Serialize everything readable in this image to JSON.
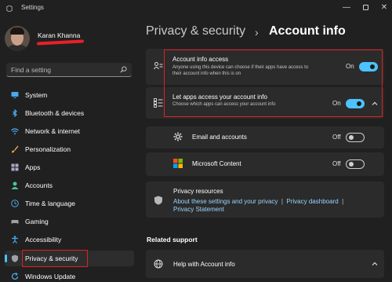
{
  "window": {
    "title": "Settings",
    "minimize": "—",
    "close": "✕"
  },
  "user": {
    "name": "Karan Khanna"
  },
  "search": {
    "placeholder": "Find a setting"
  },
  "sidebar": {
    "items": [
      {
        "label": "System",
        "icon": "monitor-icon"
      },
      {
        "label": "Bluetooth & devices",
        "icon": "bluetooth-icon"
      },
      {
        "label": "Network & internet",
        "icon": "wifi-icon"
      },
      {
        "label": "Personalization",
        "icon": "brush-icon"
      },
      {
        "label": "Apps",
        "icon": "apps-icon"
      },
      {
        "label": "Accounts",
        "icon": "person-icon"
      },
      {
        "label": "Time & language",
        "icon": "globe-clock-icon"
      },
      {
        "label": "Gaming",
        "icon": "controller-icon"
      },
      {
        "label": "Accessibility",
        "icon": "accessibility-icon"
      },
      {
        "label": "Privacy & security",
        "icon": "shield-icon",
        "selected": true
      },
      {
        "label": "Windows Update",
        "icon": "update-icon"
      }
    ]
  },
  "breadcrumb": {
    "parent": "Privacy & security",
    "separator": "›",
    "current": "Account info"
  },
  "settings": {
    "account_info_access": {
      "title": "Account info access",
      "description": "Anyone using this device can choose if their apps have access to their account info when this is on",
      "state": "On"
    },
    "let_apps_access": {
      "title": "Let apps access your account info",
      "description": "Choose which apps can access your account info",
      "state": "On"
    },
    "apps": [
      {
        "name": "Email and accounts",
        "state": "Off",
        "icon": "gear-icon"
      },
      {
        "name": "Microsoft Content",
        "state": "Off",
        "icon": "microsoft-logo-icon"
      }
    ]
  },
  "privacy_resources": {
    "title": "Privacy resources",
    "link1": "About these settings and your privacy",
    "link2": "Privacy dashboard",
    "link3": "Privacy Statement",
    "separator": "|"
  },
  "related_support": {
    "heading": "Related support",
    "help_item": "Help with Account info"
  },
  "colors": {
    "accent": "#4cc2ff",
    "background": "#202020",
    "card": "#2b2b2b",
    "annotation": "#e02020"
  }
}
